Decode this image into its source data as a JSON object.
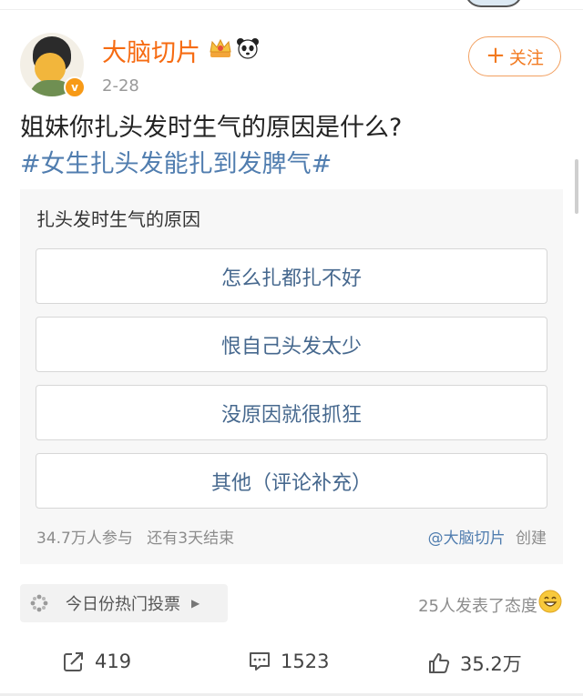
{
  "post": {
    "author": "大脑切片",
    "date": "2-28",
    "text": "姐妹你扎头发时生气的原因是什么?",
    "hashtag": "#女生扎头发能扎到发脾气#",
    "follow_label": "关注",
    "verified_badge": "v"
  },
  "vote": {
    "title": "扎头发时生气的原因",
    "options": [
      "怎么扎都扎不好",
      "恨自己头发太少",
      "没原因就很抓狂",
      "其他（评论补充）"
    ],
    "participants": "34.7万人参与",
    "remaining": "还有3天结束",
    "creator_link": "@大脑切片",
    "creator_suffix": "创建"
  },
  "footer": {
    "hot_vote_label": "今日份热门投票",
    "reaction_text": "25人发表了态度"
  },
  "actions": {
    "repost_count": "419",
    "comment_count": "1523",
    "like_count": "35.2万"
  },
  "colors": {
    "username": "#f66b12",
    "link": "#507daf",
    "option_text": "#46688e",
    "follow_border": "#f2a060"
  },
  "icons": [
    "crown-icon",
    "panda-icon",
    "burst-icon",
    "smile-icon",
    "repost-icon",
    "comment-icon",
    "like-icon"
  ]
}
